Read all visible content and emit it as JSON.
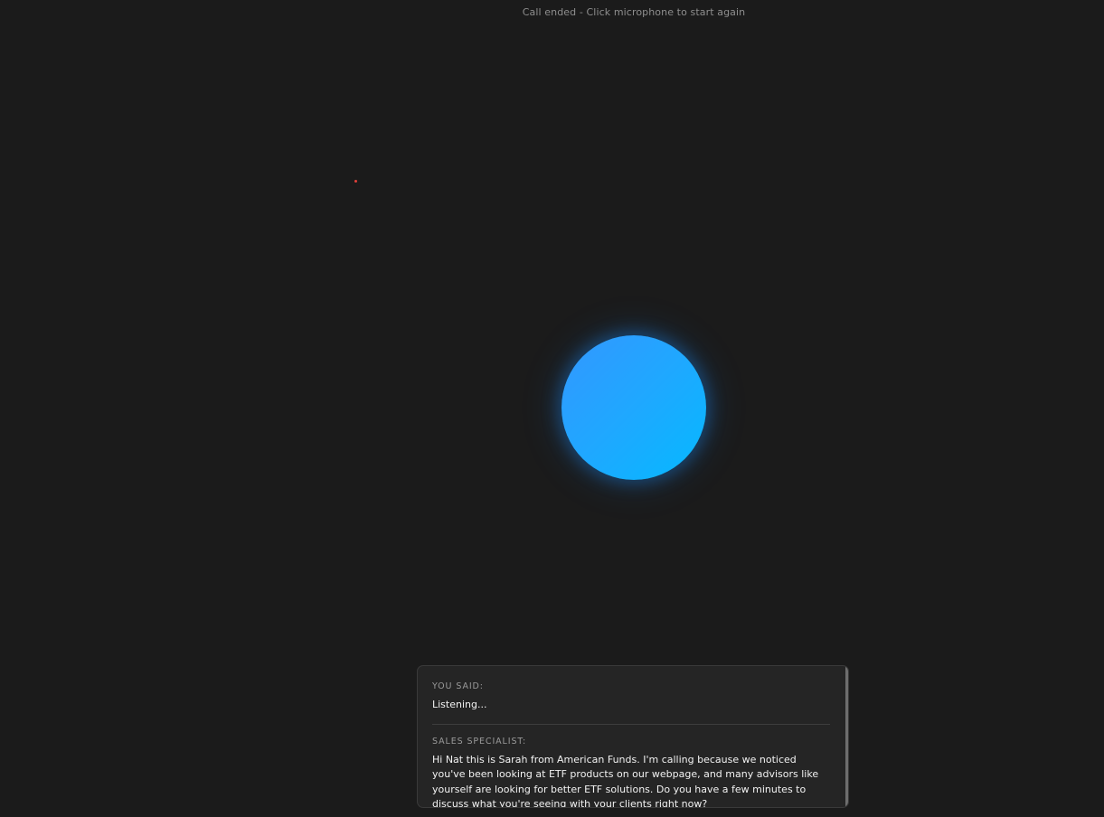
{
  "status": {
    "text": "Call ended - Click microphone to start again"
  },
  "orb": {
    "icon": "microphone-orb",
    "color_start": "#3397ff",
    "color_end": "#05b9ff"
  },
  "transcript": {
    "user": {
      "label": "YOU SAID:",
      "text": "Listening..."
    },
    "agent": {
      "label": "SALES SPECIALIST:",
      "text": "Hi Nat this is Sarah from American Funds. I'm calling because we noticed you've been looking at ETF products on our webpage, and many advisors like yourself are looking for better ETF solutions. Do you have a few minutes to discuss what you're seeing with your clients right now?"
    }
  },
  "colors": {
    "background": "#1b1b1b",
    "panel": "#252525",
    "cursor": "#e0403a"
  }
}
